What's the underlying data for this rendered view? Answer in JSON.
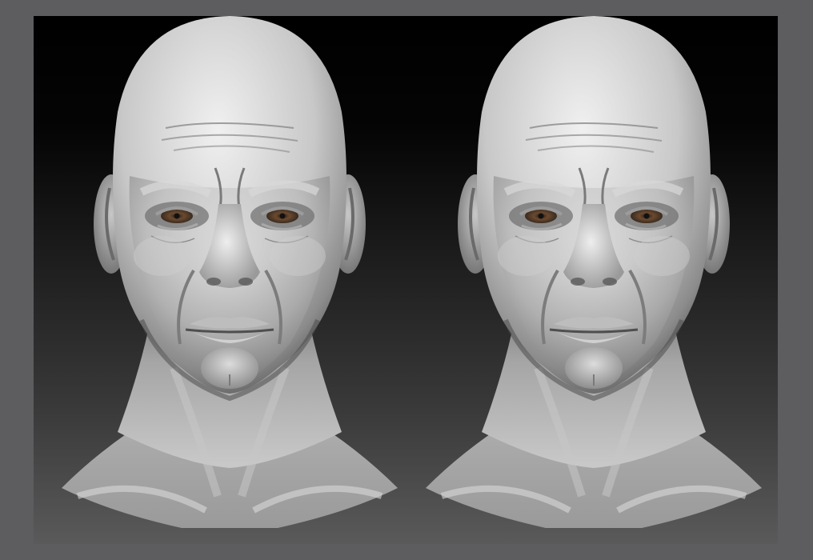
{
  "scene": {
    "frame_color": "#5d5c5e",
    "background_top": "#000000",
    "background_bottom": "#5a5a5a",
    "clay_light": "#e6e6e6",
    "clay_mid": "#a9a9a9",
    "clay_dark": "#4a4a4a",
    "iris_color": "#5a3f2a"
  },
  "renders": [
    {
      "name": "head-render-left"
    },
    {
      "name": "head-render-right"
    }
  ]
}
